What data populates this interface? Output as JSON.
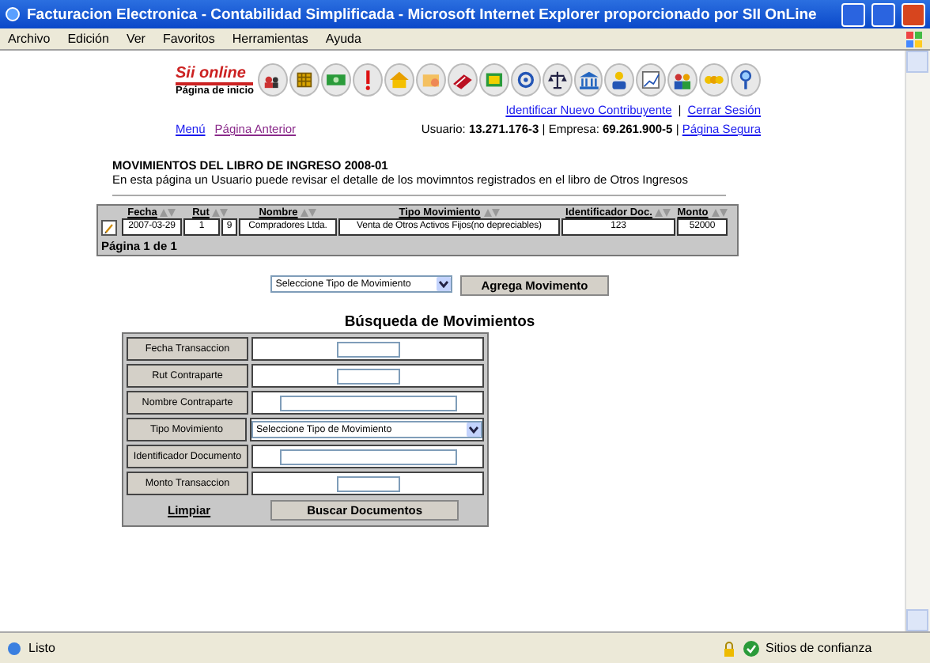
{
  "window": {
    "title": "Facturacion Electronica - Contabilidad Simplificada - Microsoft Internet Explorer proporcionado por SII OnLine"
  },
  "menu": [
    "Archivo",
    "Edición",
    "Ver",
    "Favoritos",
    "Herramientas",
    "Ayuda"
  ],
  "logo": {
    "name": "Sii online",
    "caption": "Página de inicio"
  },
  "top_links": [
    "Identificar Nuevo Contribuyente",
    "|",
    "Cerrar Sesión"
  ],
  "nav_links": [
    "Menú",
    "Página Anterior"
  ],
  "user": {
    "label": "Usuario:",
    "rut": "13.271.176-3",
    "company_label": "Empresa:",
    "company_rut": "69.261.900-5",
    "separators": [
      "|",
      "|"
    ],
    "link": "Página Segura"
  },
  "heading": "MOVIMIENTOS DEL LIBRO DE INGRESO 2008-01",
  "description": "En esta página un Usuario puede revisar el detalle de los movimntos registrados en el libro de Otros Ingresos",
  "table": {
    "columns": [
      {
        "label": "Fecha"
      },
      {
        "label": "Rut"
      },
      {
        "label": "Nombre"
      },
      {
        "label": "Tipo Movimiento"
      },
      {
        "label": "Identificador Doc."
      },
      {
        "label": "Monto"
      }
    ],
    "rows": [
      {
        "cells": [
          "2007-03-29",
          [
            "1",
            "9"
          ],
          "Compradores Ltda.",
          "Venta de Otros Activos Fijos(no depreciables)",
          "123",
          "52000"
        ]
      }
    ],
    "pager": "Página 1 de 1"
  },
  "add": {
    "select": "Seleccione Tipo de Movimiento",
    "button": "Agrega Movimento"
  },
  "search": {
    "title": "Búsqueda de Movimientos",
    "fields": [
      {
        "label": "Fecha Transaccion",
        "kind": "short"
      },
      {
        "label": "Rut Contraparte",
        "kind": "short"
      },
      {
        "label": "Nombre Contraparte",
        "kind": "long"
      },
      {
        "label": "Tipo Movimiento",
        "kind": "select",
        "value": "Seleccione Tipo de Movimiento"
      },
      {
        "label": "Identificador Documento",
        "kind": "long"
      },
      {
        "label": "Monto Transaccion",
        "kind": "short"
      }
    ],
    "clear": "Limpiar",
    "submit": "Buscar Documentos"
  },
  "status_bar": {
    "text": "Listo",
    "zone": "Sitios de confianza"
  }
}
